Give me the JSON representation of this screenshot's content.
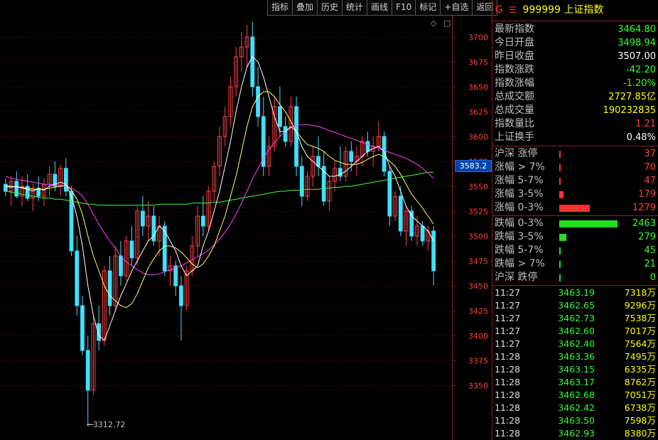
{
  "toolbar": [
    "指标",
    "叠加",
    "历史",
    "统计",
    "画线",
    "F10",
    "标记",
    "+自选",
    "返回"
  ],
  "corner": {
    "diamond_icon": "◇",
    "window_icon": "▢"
  },
  "chart_data": {
    "type": "candlestick",
    "y_ticks": [
      3700,
      3675,
      3650,
      3625,
      3600,
      3575,
      3550,
      3525,
      3500,
      3475,
      3450,
      3425,
      3400,
      3375,
      3350
    ],
    "ylim": [
      3300,
      3720
    ],
    "current_price_label": "3583.2",
    "low_marker": "3312.72",
    "colors": {
      "up": "#ff4040",
      "down": "#40e0ff",
      "ma5": "#ffffff",
      "ma10": "#ffff60",
      "ma20": "#ff40ff",
      "ma60": "#40ff40",
      "grid": "#6a1010",
      "axis": "#8a2020",
      "tick": "#ff4040"
    },
    "candles": [
      {
        "o": 3552,
        "h": 3558,
        "l": 3540,
        "c": 3545
      },
      {
        "o": 3545,
        "h": 3560,
        "l": 3530,
        "c": 3555
      },
      {
        "o": 3555,
        "h": 3565,
        "l": 3538,
        "c": 3540
      },
      {
        "o": 3540,
        "h": 3560,
        "l": 3530,
        "c": 3550
      },
      {
        "o": 3550,
        "h": 3562,
        "l": 3535,
        "c": 3538
      },
      {
        "o": 3538,
        "h": 3552,
        "l": 3525,
        "c": 3548
      },
      {
        "o": 3548,
        "h": 3560,
        "l": 3535,
        "c": 3540
      },
      {
        "o": 3540,
        "h": 3558,
        "l": 3530,
        "c": 3552
      },
      {
        "o": 3552,
        "h": 3570,
        "l": 3540,
        "c": 3562
      },
      {
        "o": 3562,
        "h": 3575,
        "l": 3545,
        "c": 3550
      },
      {
        "o": 3550,
        "h": 3572,
        "l": 3540,
        "c": 3568
      },
      {
        "o": 3568,
        "h": 3578,
        "l": 3540,
        "c": 3545
      },
      {
        "o": 3545,
        "h": 3550,
        "l": 3480,
        "c": 3485
      },
      {
        "o": 3485,
        "h": 3500,
        "l": 3420,
        "c": 3430
      },
      {
        "o": 3430,
        "h": 3440,
        "l": 3380,
        "c": 3385
      },
      {
        "o": 3385,
        "h": 3400,
        "l": 3312,
        "c": 3345
      },
      {
        "o": 3345,
        "h": 3420,
        "l": 3340,
        "c": 3412
      },
      {
        "o": 3412,
        "h": 3430,
        "l": 3385,
        "c": 3395
      },
      {
        "o": 3395,
        "h": 3470,
        "l": 3390,
        "c": 3465
      },
      {
        "o": 3465,
        "h": 3480,
        "l": 3420,
        "c": 3430
      },
      {
        "o": 3430,
        "h": 3490,
        "l": 3425,
        "c": 3480
      },
      {
        "o": 3480,
        "h": 3495,
        "l": 3450,
        "c": 3460
      },
      {
        "o": 3460,
        "h": 3500,
        "l": 3455,
        "c": 3495
      },
      {
        "o": 3495,
        "h": 3510,
        "l": 3470,
        "c": 3478
      },
      {
        "o": 3478,
        "h": 3530,
        "l": 3470,
        "c": 3525
      },
      {
        "o": 3525,
        "h": 3540,
        "l": 3500,
        "c": 3510
      },
      {
        "o": 3510,
        "h": 3535,
        "l": 3495,
        "c": 3520
      },
      {
        "o": 3520,
        "h": 3530,
        "l": 3490,
        "c": 3495
      },
      {
        "o": 3495,
        "h": 3520,
        "l": 3480,
        "c": 3510
      },
      {
        "o": 3510,
        "h": 3515,
        "l": 3460,
        "c": 3465
      },
      {
        "o": 3465,
        "h": 3480,
        "l": 3450,
        "c": 3470
      },
      {
        "o": 3470,
        "h": 3475,
        "l": 3440,
        "c": 3450
      },
      {
        "o": 3450,
        "h": 3460,
        "l": 3395,
        "c": 3430
      },
      {
        "o": 3430,
        "h": 3470,
        "l": 3425,
        "c": 3465
      },
      {
        "o": 3465,
        "h": 3500,
        "l": 3460,
        "c": 3490
      },
      {
        "o": 3490,
        "h": 3530,
        "l": 3480,
        "c": 3520
      },
      {
        "o": 3520,
        "h": 3540,
        "l": 3500,
        "c": 3510
      },
      {
        "o": 3510,
        "h": 3550,
        "l": 3505,
        "c": 3545
      },
      {
        "o": 3545,
        "h": 3575,
        "l": 3535,
        "c": 3570
      },
      {
        "o": 3570,
        "h": 3610,
        "l": 3560,
        "c": 3600
      },
      {
        "o": 3600,
        "h": 3630,
        "l": 3590,
        "c": 3620
      },
      {
        "o": 3620,
        "h": 3660,
        "l": 3610,
        "c": 3650
      },
      {
        "o": 3650,
        "h": 3690,
        "l": 3640,
        "c": 3680
      },
      {
        "o": 3680,
        "h": 3705,
        "l": 3665,
        "c": 3690
      },
      {
        "o": 3690,
        "h": 3712,
        "l": 3670,
        "c": 3700
      },
      {
        "o": 3700,
        "h": 3715,
        "l": 3640,
        "c": 3650
      },
      {
        "o": 3650,
        "h": 3670,
        "l": 3610,
        "c": 3620
      },
      {
        "o": 3620,
        "h": 3640,
        "l": 3560,
        "c": 3570
      },
      {
        "o": 3570,
        "h": 3600,
        "l": 3560,
        "c": 3590
      },
      {
        "o": 3590,
        "h": 3640,
        "l": 3585,
        "c": 3630
      },
      {
        "o": 3630,
        "h": 3650,
        "l": 3600,
        "c": 3610
      },
      {
        "o": 3610,
        "h": 3620,
        "l": 3590,
        "c": 3595
      },
      {
        "o": 3595,
        "h": 3640,
        "l": 3590,
        "c": 3630
      },
      {
        "o": 3630,
        "h": 3640,
        "l": 3560,
        "c": 3570
      },
      {
        "o": 3570,
        "h": 3580,
        "l": 3530,
        "c": 3540
      },
      {
        "o": 3540,
        "h": 3565,
        "l": 3535,
        "c": 3560
      },
      {
        "o": 3560,
        "h": 3590,
        "l": 3550,
        "c": 3580
      },
      {
        "o": 3580,
        "h": 3600,
        "l": 3560,
        "c": 3570
      },
      {
        "o": 3570,
        "h": 3585,
        "l": 3530,
        "c": 3535
      },
      {
        "o": 3535,
        "h": 3560,
        "l": 3525,
        "c": 3555
      },
      {
        "o": 3555,
        "h": 3575,
        "l": 3545,
        "c": 3568
      },
      {
        "o": 3568,
        "h": 3590,
        "l": 3555,
        "c": 3560
      },
      {
        "o": 3560,
        "h": 3590,
        "l": 3555,
        "c": 3585
      },
      {
        "o": 3585,
        "h": 3595,
        "l": 3565,
        "c": 3575
      },
      {
        "o": 3575,
        "h": 3590,
        "l": 3560,
        "c": 3580
      },
      {
        "o": 3580,
        "h": 3600,
        "l": 3570,
        "c": 3595
      },
      {
        "o": 3595,
        "h": 3605,
        "l": 3580,
        "c": 3585
      },
      {
        "o": 3585,
        "h": 3600,
        "l": 3570,
        "c": 3590
      },
      {
        "o": 3590,
        "h": 3615,
        "l": 3585,
        "c": 3600
      },
      {
        "o": 3600,
        "h": 3605,
        "l": 3560,
        "c": 3565
      },
      {
        "o": 3565,
        "h": 3570,
        "l": 3510,
        "c": 3520
      },
      {
        "o": 3520,
        "h": 3545,
        "l": 3515,
        "c": 3540
      },
      {
        "o": 3540,
        "h": 3550,
        "l": 3500,
        "c": 3505
      },
      {
        "o": 3505,
        "h": 3530,
        "l": 3490,
        "c": 3525
      },
      {
        "o": 3525,
        "h": 3530,
        "l": 3495,
        "c": 3500
      },
      {
        "o": 3500,
        "h": 3520,
        "l": 3490,
        "c": 3510
      },
      {
        "o": 3510,
        "h": 3515,
        "l": 3490,
        "c": 3495
      },
      {
        "o": 3495,
        "h": 3510,
        "l": 3485,
        "c": 3505
      },
      {
        "o": 3505,
        "h": 3510,
        "l": 3450,
        "c": 3465
      }
    ],
    "ma5": [
      3550,
      3549,
      3550,
      3548,
      3547,
      3545,
      3548,
      3546,
      3550,
      3552,
      3554,
      3552,
      3540,
      3520,
      3490,
      3450,
      3420,
      3400,
      3395,
      3410,
      3425,
      3440,
      3452,
      3465,
      3475,
      3485,
      3495,
      3500,
      3510,
      3505,
      3495,
      3485,
      3470,
      3460,
      3465,
      3470,
      3490,
      3505,
      3525,
      3545,
      3570,
      3595,
      3625,
      3650,
      3670,
      3680,
      3675,
      3660,
      3640,
      3620,
      3605,
      3605,
      3610,
      3605,
      3590,
      3580,
      3575,
      3570,
      3565,
      3560,
      3560,
      3562,
      3565,
      3570,
      3575,
      3580,
      3585,
      3588,
      3590,
      3585,
      3570,
      3560,
      3545,
      3530,
      3520,
      3515,
      3510,
      3505,
      3495
    ],
    "ma10": [
      3550,
      3550,
      3549,
      3549,
      3548,
      3547,
      3547,
      3547,
      3548,
      3549,
      3550,
      3551,
      3546,
      3537,
      3522,
      3500,
      3480,
      3465,
      3450,
      3440,
      3435,
      3430,
      3428,
      3432,
      3442,
      3455,
      3468,
      3477,
      3485,
      3490,
      3490,
      3488,
      3484,
      3478,
      3472,
      3468,
      3472,
      3480,
      3490,
      3505,
      3520,
      3540,
      3560,
      3585,
      3610,
      3630,
      3640,
      3645,
      3645,
      3640,
      3632,
      3625,
      3615,
      3605,
      3598,
      3592,
      3590,
      3588,
      3585,
      3580,
      3576,
      3574,
      3572,
      3572,
      3572,
      3574,
      3577,
      3580,
      3582,
      3580,
      3575,
      3570,
      3562,
      3552,
      3542,
      3535,
      3528,
      3520,
      3512
    ],
    "ma20": [
      3560,
      3558,
      3557,
      3556,
      3555,
      3554,
      3553,
      3552,
      3552,
      3551,
      3551,
      3550,
      3548,
      3545,
      3540,
      3532,
      3522,
      3512,
      3503,
      3495,
      3488,
      3480,
      3474,
      3470,
      3466,
      3463,
      3461,
      3461,
      3462,
      3464,
      3466,
      3468,
      3470,
      3473,
      3476,
      3479,
      3482,
      3486,
      3491,
      3497,
      3504,
      3512,
      3522,
      3533,
      3545,
      3557,
      3568,
      3578,
      3587,
      3594,
      3600,
      3605,
      3609,
      3611,
      3612,
      3612,
      3611,
      3610,
      3608,
      3606,
      3604,
      3602,
      3600,
      3598,
      3596,
      3594,
      3592,
      3590,
      3588,
      3586,
      3584,
      3582,
      3580,
      3578,
      3575,
      3572,
      3568,
      3563,
      3558
    ],
    "ma60": [
      3545,
      3544,
      3543,
      3542,
      3541,
      3540,
      3539,
      3538,
      3538,
      3537,
      3537,
      3536,
      3535,
      3534,
      3533,
      3532,
      3532,
      3531,
      3531,
      3531,
      3531,
      3531,
      3531,
      3531,
      3531,
      3531,
      3531,
      3531,
      3532,
      3532,
      3532,
      3532,
      3532,
      3532,
      3533,
      3533,
      3533,
      3533,
      3534,
      3534,
      3535,
      3536,
      3537,
      3538,
      3539,
      3540,
      3541,
      3542,
      3543,
      3544,
      3545,
      3545,
      3546,
      3546,
      3546,
      3547,
      3547,
      3547,
      3548,
      3548,
      3549,
      3549,
      3550,
      3550,
      3551,
      3552,
      3553,
      3554,
      3555,
      3556,
      3557,
      3558,
      3559,
      3560,
      3561,
      3562,
      3563,
      3564,
      3564
    ]
  },
  "panel": {
    "g_icon": "G",
    "menu_icon": "☰",
    "code": "999999",
    "name": "上证指数",
    "quote": [
      {
        "k": "最新指数",
        "v": "3464.80",
        "c": "#30ff30"
      },
      {
        "k": "今日开盘",
        "v": "3498.94",
        "c": "#30ff30"
      },
      {
        "k": "昨日收盘",
        "v": "3507.00",
        "c": "#ffffff"
      },
      {
        "k": "指数涨跌",
        "v": "-42.20",
        "c": "#30ff30"
      },
      {
        "k": "指数涨幅",
        "v": "-1.20%",
        "c": "#30ff30"
      },
      {
        "k": "总成交额",
        "v": "2727.85亿",
        "c": "#ffff00"
      },
      {
        "k": "总成交量",
        "v": "190232835",
        "c": "#ffff00"
      },
      {
        "k": "指数量比",
        "v": "1.21",
        "c": "#ff4040"
      },
      {
        "k": "上证换手",
        "v": "0.48%",
        "c": "#ffffff"
      }
    ],
    "up_dist": [
      {
        "k": "沪深 涨停",
        "v": "37",
        "frac": 0.015
      },
      {
        "k": "涨幅 > 7%",
        "v": "70",
        "frac": 0.03
      },
      {
        "k": "涨幅 5-7%",
        "v": "47",
        "frac": 0.02
      },
      {
        "k": "涨幅 3-5%",
        "v": "179",
        "frac": 0.07
      },
      {
        "k": "涨幅 0-3%",
        "v": "1279",
        "frac": 0.52
      }
    ],
    "down_dist": [
      {
        "k": "跌幅 0-3%",
        "v": "2463",
        "frac": 1.0
      },
      {
        "k": "跌幅 3-5%",
        "v": "279",
        "frac": 0.12
      },
      {
        "k": "跌幅 5-7%",
        "v": "45",
        "frac": 0.02
      },
      {
        "k": "跌幅 > 7%",
        "v": "21",
        "frac": 0.015
      },
      {
        "k": "沪深 跌停",
        "v": "0",
        "frac": 0.01
      }
    ],
    "ticks": [
      {
        "t": "11:27",
        "p": "3463.19",
        "v": "7318万"
      },
      {
        "t": "11:27",
        "p": "3462.65",
        "v": "9296万"
      },
      {
        "t": "11:27",
        "p": "3462.73",
        "v": "7538万"
      },
      {
        "t": "11:27",
        "p": "3462.60",
        "v": "7017万"
      },
      {
        "t": "11:27",
        "p": "3462.40",
        "v": "7564万"
      },
      {
        "t": "11:28",
        "p": "3463.36",
        "v": "7495万"
      },
      {
        "t": "11:28",
        "p": "3463.15",
        "v": "6335万"
      },
      {
        "t": "11:28",
        "p": "3463.17",
        "v": "8762万"
      },
      {
        "t": "11:28",
        "p": "3462.68",
        "v": "7051万"
      },
      {
        "t": "11:28",
        "p": "3462.42",
        "v": "6738万"
      },
      {
        "t": "11:28",
        "p": "3463.50",
        "v": "7598万"
      },
      {
        "t": "11:28",
        "p": "3462.93",
        "v": "8380万"
      }
    ]
  }
}
